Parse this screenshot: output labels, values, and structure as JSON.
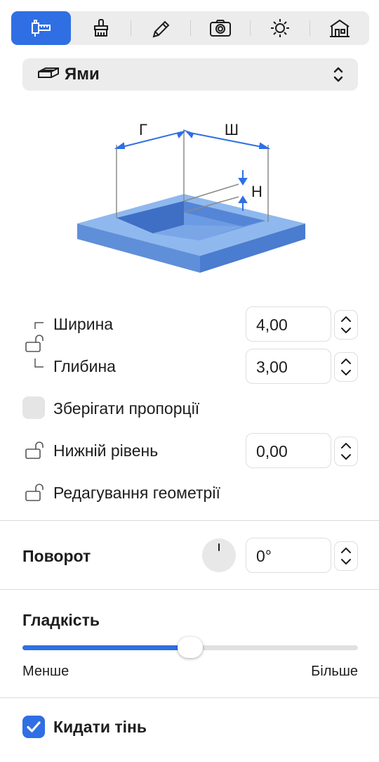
{
  "toolbar": {
    "items": [
      {
        "icon": "measure-tools-icon",
        "active": true
      },
      {
        "icon": "brush-icon",
        "active": false
      },
      {
        "icon": "pencil-icon",
        "active": false
      },
      {
        "icon": "camera-icon",
        "active": false
      },
      {
        "icon": "sun-icon",
        "active": false
      },
      {
        "icon": "building-icon",
        "active": false
      }
    ]
  },
  "type_select": {
    "label": "Ями",
    "icon": "pit-icon"
  },
  "diagram": {
    "label_depth": "Г",
    "label_width": "Ш",
    "label_height": "Н"
  },
  "dimensions": {
    "width": {
      "label": "Ширина",
      "value": "4,00"
    },
    "depth": {
      "label": "Глибина",
      "value": "3,00"
    },
    "keep_proportions": {
      "label": "Зберігати пропорції",
      "checked": false
    },
    "bottom_level": {
      "label": "Нижній рівень",
      "value": "0,00"
    },
    "edit_geometry": {
      "label": "Редагування геометрії"
    }
  },
  "rotation": {
    "title": "Поворот",
    "value": "0°"
  },
  "smoothness": {
    "title": "Гладкість",
    "min_label": "Менше",
    "max_label": "Більше",
    "level": 0.5
  },
  "cast_shadow": {
    "label": "Кидати тінь",
    "checked": true
  },
  "colors": {
    "accent": "#2f6fe3",
    "fill_light": "#8fb8ee",
    "fill_dark": "#5f8fd8"
  }
}
